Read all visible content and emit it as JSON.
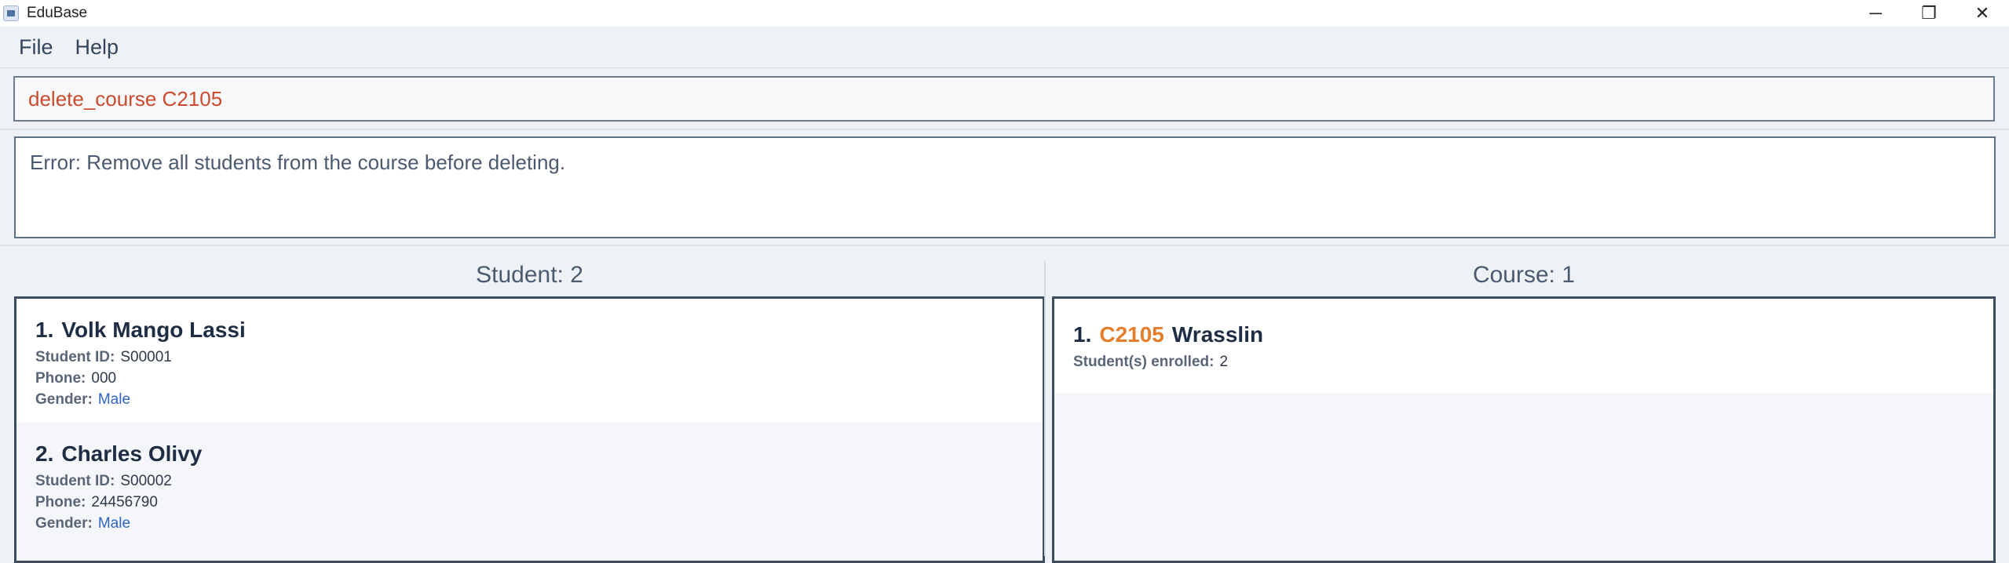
{
  "window": {
    "title": "EduBase",
    "minimize_icon": "─",
    "maximize_icon": "❐",
    "close_icon": "✕"
  },
  "menu": {
    "items": [
      {
        "label": "File"
      },
      {
        "label": "Help"
      }
    ]
  },
  "command": {
    "value": "delete_course C2105"
  },
  "result": {
    "message": "Error: Remove all students from the course before deleting."
  },
  "students": {
    "header": "Student: 2",
    "labels": {
      "id": "Student ID:",
      "phone": "Phone:",
      "gender": "Gender:"
    },
    "items": [
      {
        "index": "1.",
        "name": "Volk Mango Lassi",
        "id": "S00001",
        "phone": "000",
        "gender": "Male"
      },
      {
        "index": "2.",
        "name": "Charles Olivy",
        "id": "S00002",
        "phone": "24456790",
        "gender": "Male"
      }
    ]
  },
  "courses": {
    "header": "Course: 1",
    "labels": {
      "enrolled": "Student(s) enrolled:"
    },
    "items": [
      {
        "index": "1.",
        "code": "C2105",
        "name": "Wrasslin",
        "enrolled": "2"
      }
    ]
  },
  "colors": {
    "command_text": "#cc4a2b",
    "course_code": "#e57e2a",
    "gender_link": "#2f64c0",
    "background": "#eef2f6"
  }
}
